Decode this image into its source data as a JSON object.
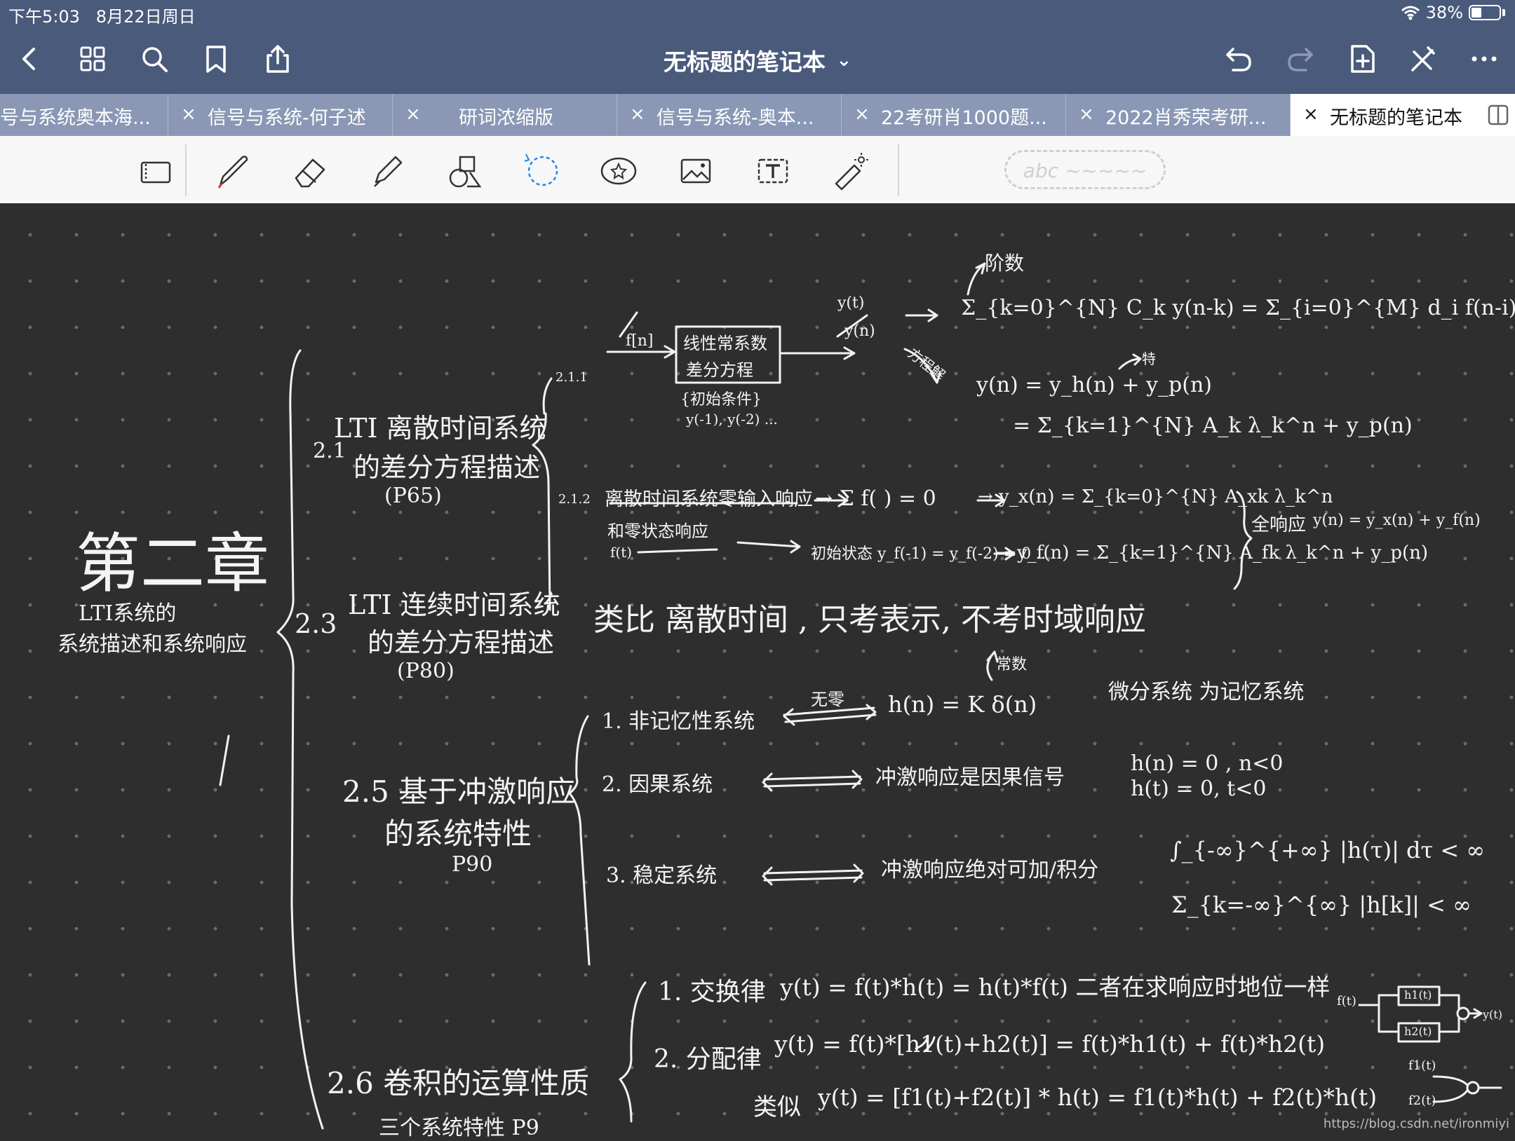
{
  "status": {
    "time": "下午5:03",
    "date": "8月22日周日",
    "battery": "38%",
    "battery_level": 0.38
  },
  "nav": {
    "title": "无标题的笔记本",
    "title_chevron": "⌄",
    "icons": [
      "back-icon",
      "grid-icon",
      "search-icon",
      "bookmark-icon",
      "share-icon",
      "undo-icon",
      "redo-icon",
      "add-page-icon",
      "close-tools-icon",
      "more-icon"
    ]
  },
  "tabs": [
    {
      "label": "号与系统奥本海...",
      "close": ""
    },
    {
      "label": "信号与系统-何子述",
      "close": "×"
    },
    {
      "label": "研词浓缩版",
      "close": "×"
    },
    {
      "label": "信号与系统-奥本...",
      "close": "×"
    },
    {
      "label": "22考研肖1000题...",
      "close": "×"
    },
    {
      "label": "2022肖秀荣考研...",
      "close": "×"
    },
    {
      "label": "无标题的笔记本",
      "close": "×",
      "active": true
    }
  ],
  "toolbar": {
    "tools": [
      "lasso-page-icon",
      "pen-icon",
      "eraser-icon",
      "highlighter-icon",
      "shapes-icon",
      "lasso-icon",
      "sticker-icon",
      "image-icon",
      "text-icon",
      "laser-pointer-icon"
    ],
    "ink_preview": "abc ~~~~~"
  },
  "notes": {
    "chapter_title": "第二章",
    "chapter_subtitle_1": "LTI系统的",
    "chapter_subtitle_2": "系统描述和系统响应",
    "sec_2_1_num": "2.1",
    "sec_2_1_line1": "LTI 离散时间系统",
    "sec_2_1_line2": "的差分方程描述",
    "sec_2_1_line3": "(P65)",
    "sec_2_3_num": "2.3",
    "sec_2_3_line1": "LTI 连续时间系统",
    "sec_2_3_line2": "的差分方程描述",
    "sec_2_3_line3": "(P80)",
    "sec_2_5_line1": "2.5 基于冲激响应",
    "sec_2_5_line2": "的系统特性",
    "sec_2_5_line3": "P90",
    "sec_2_6_line1": "2.6 卷积的运算性质",
    "sec_2_6_line2": "三个系统特性 P9",
    "sub_2_1_1": "2.1.1",
    "sub_2_1_2": "2.1.2",
    "box_line1": "线性常系数",
    "box_line2": "差分方程",
    "box_input": "f[n]",
    "box_initial": "{初始条件}",
    "box_initial_vals": "y(-1), y(-2) ...",
    "box_output_1": "y(t)",
    "box_output_2": "y(n)",
    "order_label": "阶数",
    "diff_eq": "Σ_{k=0}^{N} C_k y(n-k) = Σ_{i=0}^{M} d_i f(n-i)",
    "solve_label": "方程解",
    "special_label": "特",
    "solution_1": "y(n) = y_h(n) + y_p(n)",
    "solution_2": "= Σ_{k=1}^{N} A_k λ_k^n + y_p(n)",
    "zero_line1": "离散时间系统零输入响应",
    "zero_line2": "和零状态响应",
    "zero_f": "f(t)",
    "zero_sum": "→ Σ f(  ) = 0",
    "zero_in": "→ y_x(n) = Σ_{k=0}^{N} A_xk λ_k^n",
    "zero_state_init": "初始状态 y_f(-1) = y_f(-2) = 0 ..",
    "zero_state": "→ y_f(n) = Σ_{k=1}^{N} A_fk λ_k^n + y_p(n)",
    "full_label": "全响应",
    "full_eq": "y(n) = y_x(n) + y_f(n)",
    "analog_note": "类比 离散时间 , 只考表示, 不考时域响应",
    "mem_label": "1. 非记忆性系统",
    "mem_arrow": "无零",
    "mem_eq": "h(n) = K δ(n)",
    "mem_const": "常数",
    "mem_note": "微分系统 为记忆系统",
    "causal_label": "2. 因果系统",
    "causal_desc": "冲激响应是因果信号",
    "causal_eq1": "h(n) = 0 ,  n<0",
    "causal_eq2": "h(t) = 0,   t<0",
    "stable_label": "3. 稳定系统",
    "stable_desc": "冲激响应绝对可加/积分",
    "stable_eq1": "∫_{-∞}^{+∞} |h(τ)| dτ < ∞",
    "stable_eq2": "Σ_{k=-∞}^{∞} |h[k]| < ∞",
    "comm_label": "1. 交换律",
    "comm_eq": "y(t) = f(t)*h(t) = h(t)*f(t)   二者在求响应时地位一样",
    "dist_label": "2. 分配律",
    "dist_eq": "y(t) = f(t)*[h1(t)+h2(t)] = f(t)*h1(t) + f(t)*h2(t)",
    "similar_label": "类似",
    "similar_eq": "y(t) = [f1(t)+f2(t)] * h(t)  =  f1(t)*h(t) + f2(t)*h(t)",
    "diag_in": "f(t)",
    "diag_h1": "h1(t)",
    "diag_h2": "h2(t)",
    "diag_out": "y(t)",
    "diag2_f1": "f1(t)",
    "diag2_f2": "f2(t)"
  },
  "watermark": "https://blog.csdn.net/ironmiyi"
}
